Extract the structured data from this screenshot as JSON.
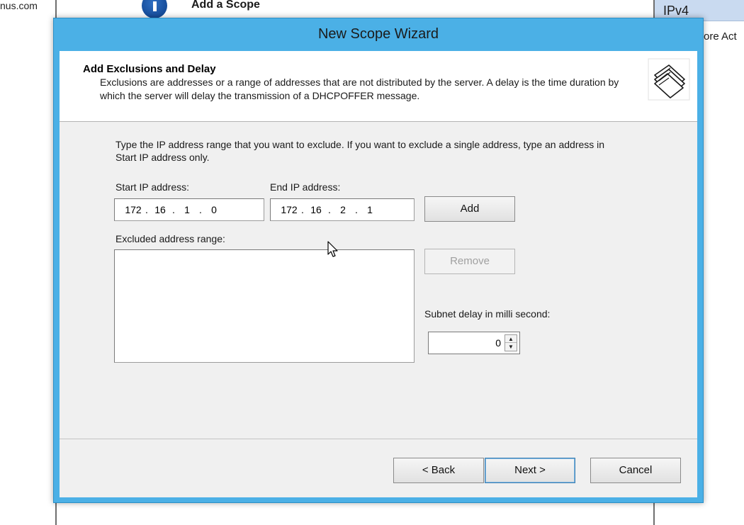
{
  "background": {
    "left_text": "nus.com",
    "wizard_title": "Add a Scope",
    "right_tab": "IPv4",
    "right_text": "ore Act"
  },
  "dialog": {
    "title": "New Scope Wizard",
    "header": {
      "title": "Add Exclusions and Delay",
      "description": "Exclusions are addresses or a range of addresses that are not distributed by the server. A delay is the time duration by which the server will delay the transmission of a DHCPOFFER message.",
      "icon": "folder-stack-icon"
    },
    "instructions": "Type the IP address range that you want to exclude. If you want to exclude a single address, type an address in Start IP address only.",
    "start_ip": {
      "label": "Start IP address:",
      "octets": [
        "172",
        "16",
        "1",
        "0"
      ]
    },
    "end_ip": {
      "label": "End IP address:",
      "octets": [
        "172",
        "16",
        "2",
        "1"
      ]
    },
    "add_label": "Add",
    "excluded_label": "Excluded address range:",
    "excluded_items": [],
    "remove_label": "Remove",
    "subnet_delay": {
      "label": "Subnet delay in milli second:",
      "value": "0"
    },
    "buttons": {
      "back": "< Back",
      "next": "Next >",
      "cancel": "Cancel"
    }
  }
}
